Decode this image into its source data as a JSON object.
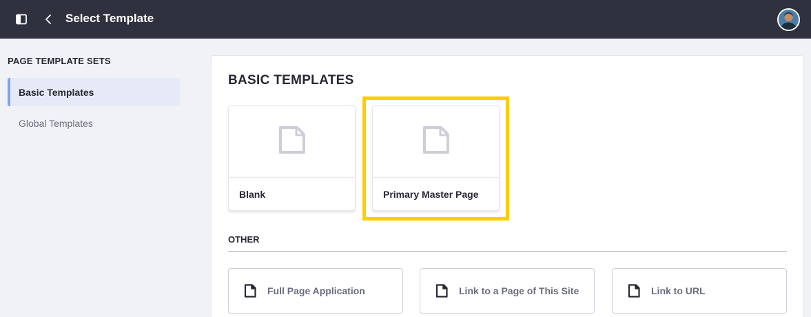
{
  "header": {
    "title": "Select Template",
    "panel_toggle_icon": "sidebar-panel-icon",
    "back_icon": "chevron-left-icon",
    "avatar_icon": "user-avatar"
  },
  "sidebar": {
    "heading": "PAGE TEMPLATE SETS",
    "items": [
      {
        "label": "Basic Templates",
        "active": true
      },
      {
        "label": "Global Templates",
        "active": false
      }
    ]
  },
  "main": {
    "section_title": "BASIC TEMPLATES",
    "cards": [
      {
        "label": "Blank",
        "icon": "page-icon"
      },
      {
        "label": "Primary Master Page",
        "icon": "page-icon"
      }
    ],
    "other_heading": "OTHER",
    "other_items": [
      {
        "label": "Full Page Application",
        "icon": "page-icon"
      },
      {
        "label": "Link to a Page of This Site",
        "icon": "page-icon"
      },
      {
        "label": "Link to URL",
        "icon": "page-icon"
      }
    ]
  },
  "colors": {
    "topbar": "#30313f",
    "highlight": "#ffcd05",
    "active_item_bg": "#e5eaf6",
    "active_item_border": "#7fa3e6"
  }
}
